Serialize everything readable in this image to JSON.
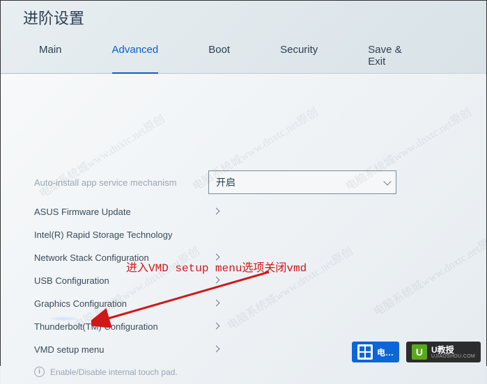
{
  "page_title": "进阶设置",
  "tabs": [
    "Main",
    "Advanced",
    "Boot",
    "Security",
    "Save & Exit"
  ],
  "active_tab_index": 1,
  "rows": {
    "auto_install": {
      "label": "Auto-install app service mechanism",
      "value": "开启"
    },
    "asus_fw": {
      "label": "ASUS Firmware Update"
    },
    "intel_rst": {
      "label": "Intel(R) Rapid Storage Technology"
    },
    "net_stack": {
      "label": "Network Stack Configuration"
    },
    "usb": {
      "label": "USB Configuration"
    },
    "gfx": {
      "label": "Graphics Configuration"
    },
    "tbt": {
      "label": "Thunderbolt(TM) Configuration"
    },
    "vmd": {
      "label": "VMD setup menu"
    }
  },
  "hint": {
    "text": "Enable/Disable internal touch pad."
  },
  "annotation": {
    "text": "进入VMD setup menu选项关闭vmd"
  },
  "watermark": "电脑系统城www.dnxtc.net原创",
  "logos": {
    "a_text": "电…",
    "b_text": "U教授",
    "b_sub": "UJIAOSHOU.COM"
  }
}
